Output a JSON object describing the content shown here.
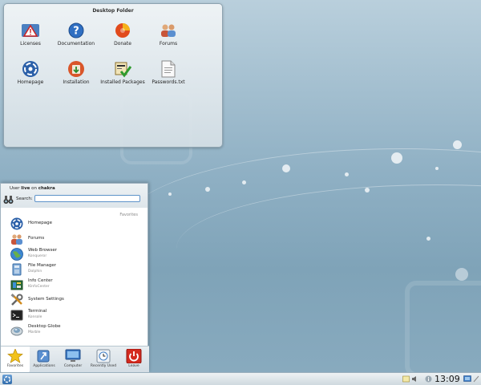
{
  "folder": {
    "title": "Desktop Folder",
    "icons": [
      {
        "label": "Licenses",
        "icon": "warning-icon"
      },
      {
        "label": "Documentation",
        "icon": "help-icon"
      },
      {
        "label": "Donate",
        "icon": "donate-icon"
      },
      {
        "label": "Forums",
        "icon": "forums-icon"
      },
      {
        "label": "Homepage",
        "icon": "chakra-icon"
      },
      {
        "label": "Installation",
        "icon": "installation-icon"
      },
      {
        "label": "Installed Packages",
        "icon": "packages-icon"
      },
      {
        "label": "Passwords.txt",
        "icon": "text-file-icon"
      }
    ]
  },
  "menu": {
    "user_prefix": "User ",
    "user_name": "live",
    "user_mid": " on ",
    "host": "chakra",
    "search_label": "Search:",
    "search_value": "",
    "favorites_header": "Favorites",
    "items": [
      {
        "title": "Homepage",
        "subtitle": ""
      },
      {
        "title": "Forums",
        "subtitle": ""
      },
      {
        "title": "Web Browser",
        "subtitle": "Konqueror"
      },
      {
        "title": "File Manager",
        "subtitle": "Dolphin"
      },
      {
        "title": "Info Center",
        "subtitle": "KInfoCenter"
      },
      {
        "title": "System Settings",
        "subtitle": ""
      },
      {
        "title": "Terminal",
        "subtitle": "Konsole"
      },
      {
        "title": "Desktop Globe",
        "subtitle": "Marble"
      }
    ],
    "tabs": [
      {
        "label": "Favorites"
      },
      {
        "label": "Applications"
      },
      {
        "label": "Computer"
      },
      {
        "label": "Recently Used"
      },
      {
        "label": "Leave"
      }
    ]
  },
  "panel": {
    "clock": "13:09"
  },
  "colors": {
    "accent": "#3d7cc4",
    "leave": "#d42a1e"
  }
}
